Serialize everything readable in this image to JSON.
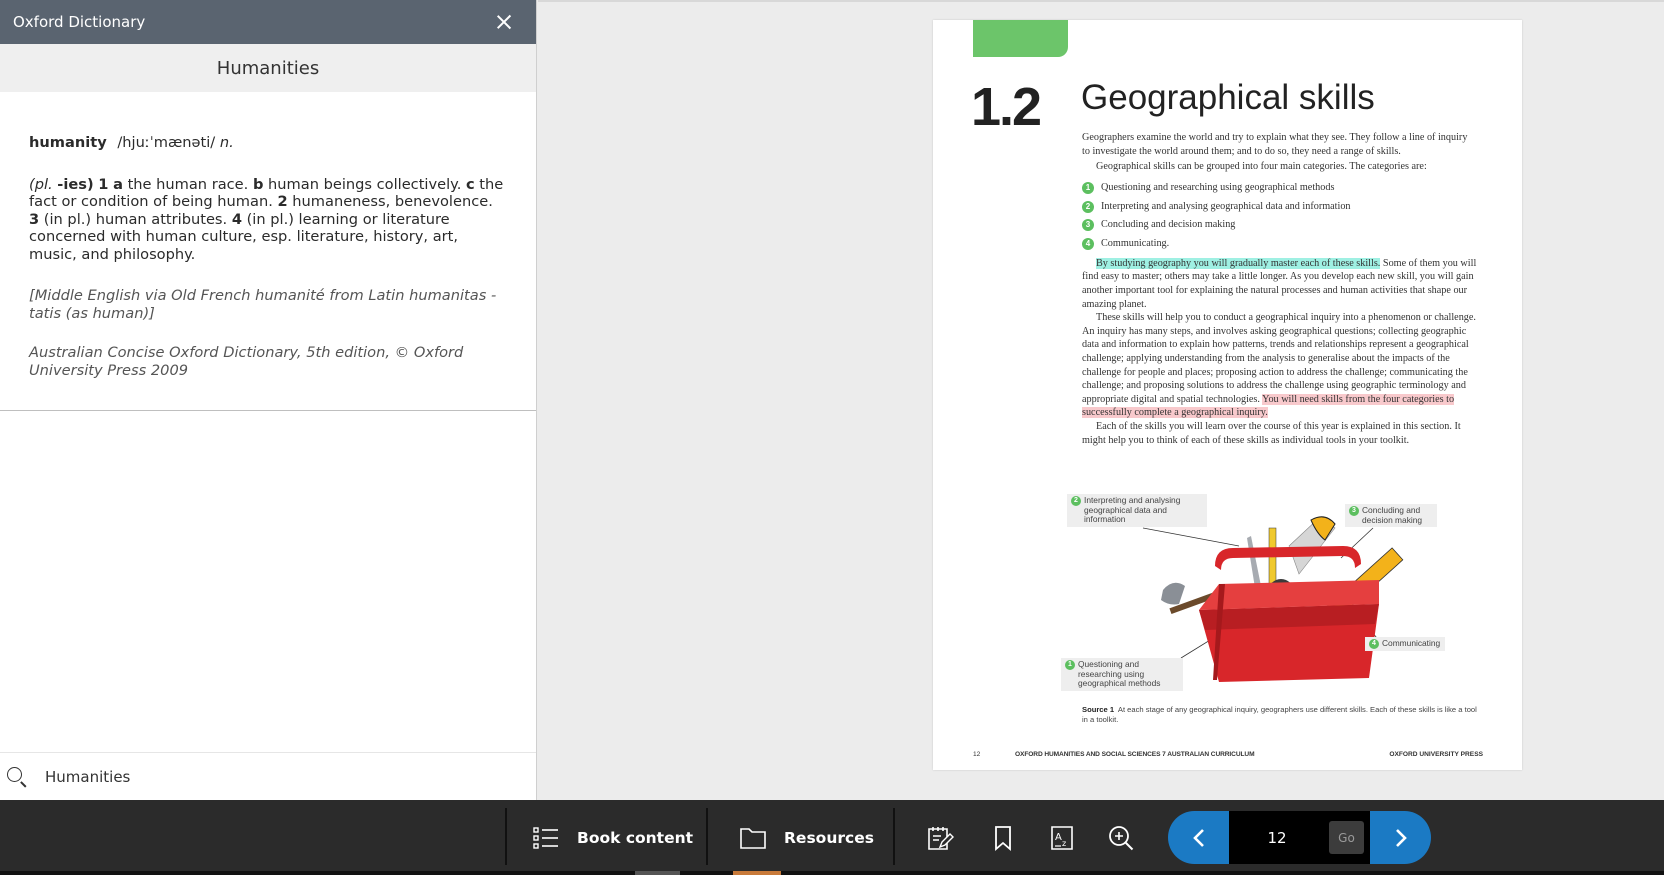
{
  "dictionary": {
    "panel_title": "Oxford Dictionary",
    "subject": "Humanities",
    "entry": {
      "headword": "humanity",
      "pronunciation": "/hjuːˈmænəti/",
      "part_of_speech": "n.",
      "plural_prefix": "(pl.",
      "plural_suffix": "-ies)",
      "d1_num": "1",
      "d1a_label": "a",
      "d1a_text": "the human race.",
      "d1b_label": "b",
      "d1b_text": "human beings collectively.",
      "d1c_label": "c",
      "d1c_text": "the fact or condition of being human.",
      "d2_num": "2",
      "d2_text": "humaneness, benevolence.",
      "d3_num": "3",
      "d3_text": "(in pl.) human attributes.",
      "d4_num": "4",
      "d4_text": "(in pl.) learning or literature concerned with human culture, esp. literature, history, art, music, and philosophy.",
      "etymology": "[Middle English via Old French humanité from Latin humanitas -tatis (as human)]",
      "source": "Australian Concise Oxford Dictionary, 5th edition, © Oxford University Press 2009"
    },
    "search_value": "Humanities"
  },
  "book_page": {
    "section_number": "1.2",
    "section_title": "Geographical skills",
    "intro": "Geographers examine the world and try to explain what they see. They follow a line of inquiry to investigate the world around them; and to do so, they need a range of skills.",
    "categories_intro": "Geographical skills can be grouped into four main categories. The categories are:",
    "skills": [
      {
        "num": "1",
        "text": "Questioning and researching using geographical methods"
      },
      {
        "num": "2",
        "text": "Interpreting and analysing geographical data and information"
      },
      {
        "num": "3",
        "text": "Concluding and decision making"
      },
      {
        "num": "4",
        "text": "Communicating."
      }
    ],
    "para2_highlight": "By studying geography you will gradually master each of these skills.",
    "para2_rest": " Some of them you will find easy to master; others may take a little longer. As you develop each new skill, you will gain another important tool for explaining the natural processes and human activities that shape our amazing planet.",
    "para3_text": "These skills will help you to conduct a geographical inquiry into a phenomenon or challenge. An inquiry has many steps, and involves asking geographical questions; collecting geographic data and information to explain how patterns, trends and relationships represent a geographical challenge; applying understanding from the analysis to generalise about the impacts of the challenge for people and places; proposing action to address the challenge; communicating the challenge; and proposing solutions to address the challenge using geographic terminology and appropriate digital and spatial technologies. ",
    "para3_highlight": "You will need skills from the four categories to successfully complete a geographical inquiry.",
    "para4": "Each of the skills you will learn over the course of this year is explained in this section. It might help you to think of each of these skills as individual tools in your toolkit.",
    "callouts": {
      "c2_num": "2",
      "c2_text": "Interpreting and analysing geographical data and information",
      "c3_num": "3",
      "c3_text": "Concluding and decision making",
      "c4_num": "4",
      "c4_text": "Communicating",
      "c1_num": "1",
      "c1_text": "Questioning and researching using geographical methods"
    },
    "caption_label": "Source 1",
    "caption_text": "At each stage of any geographical inquiry, geographers use different skills. Each of these skills is like a tool in a toolkit.",
    "footer_page": "12",
    "footer_book": "OXFORD HUMANITIES AND SOCIAL SCIENCES 7  AUSTRALIAN CURRICULUM",
    "footer_publisher": "OXFORD UNIVERSITY PRESS"
  },
  "toolbar": {
    "book_content_label": "Book content",
    "resources_label": "Resources",
    "icons": [
      "notes-icon",
      "bookmark-icon",
      "dictionary-icon",
      "zoom-in-icon"
    ],
    "page_number": "12",
    "go_label": "Go"
  },
  "colors": {
    "dict_header": "#5a6470",
    "highlight_teal": "#9ff0e3",
    "highlight_pink": "#f8c9cc",
    "nav_blue": "#1b7ac4",
    "section_green": "#6cc56a"
  }
}
